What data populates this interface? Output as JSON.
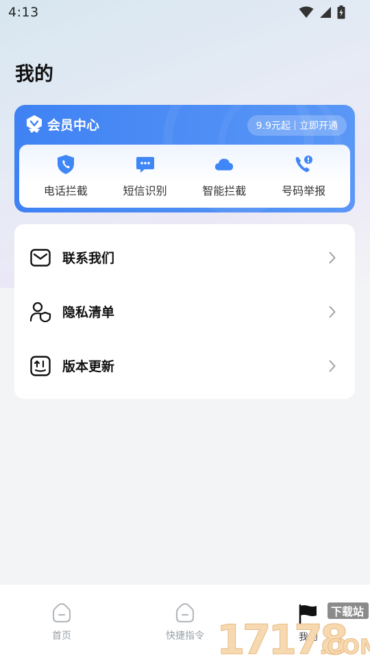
{
  "status_bar": {
    "time": "4:13"
  },
  "page": {
    "title": "我的"
  },
  "member_center": {
    "title": "会员中心",
    "price": "9.9元起",
    "cta": "立即开通",
    "features": [
      {
        "label": "电话拦截",
        "icon": "phone-shield-icon"
      },
      {
        "label": "短信识别",
        "icon": "message-bubble-icon"
      },
      {
        "label": "智能拦截",
        "icon": "cloud-icon"
      },
      {
        "label": "号码举报",
        "icon": "phone-report-icon"
      }
    ]
  },
  "menu": {
    "items": [
      {
        "label": "联系我们",
        "icon": "mail-icon"
      },
      {
        "label": "隐私清单",
        "icon": "privacy-user-icon"
      },
      {
        "label": "版本更新",
        "icon": "update-icon"
      }
    ]
  },
  "bottom_nav": {
    "items": [
      {
        "label": "首页",
        "icon": "home-icon"
      },
      {
        "label": "快捷指令",
        "icon": "home-icon"
      },
      {
        "label": "我的",
        "icon": "flag-icon"
      }
    ]
  },
  "watermark": {
    "brand": "17178",
    "suffix": ".COM",
    "tag": "下载站"
  },
  "colors": {
    "accent": "#3f82f3",
    "icon_blue": "#3f86f7"
  }
}
